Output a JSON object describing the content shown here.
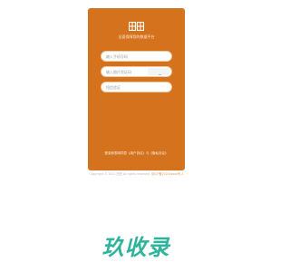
{
  "brand": {
    "logo_text": "田田",
    "subtitle": "全面保障我的数据平台"
  },
  "form": {
    "phone_placeholder": "输入手机号码",
    "captcha_placeholder": "输入图片验证码",
    "sms_placeholder": "短信验证"
  },
  "agreement_text": "登录即表明同意《用户协议》与《隐私协议》",
  "footer": {
    "copyright": "Copyright © 2022 田田 All rights reserved.",
    "icp": "京ICP备2022xxxxx号-1"
  },
  "watermark": "玖收录",
  "colors": {
    "card": "#d4721e",
    "watermark": "#2fb39a"
  }
}
